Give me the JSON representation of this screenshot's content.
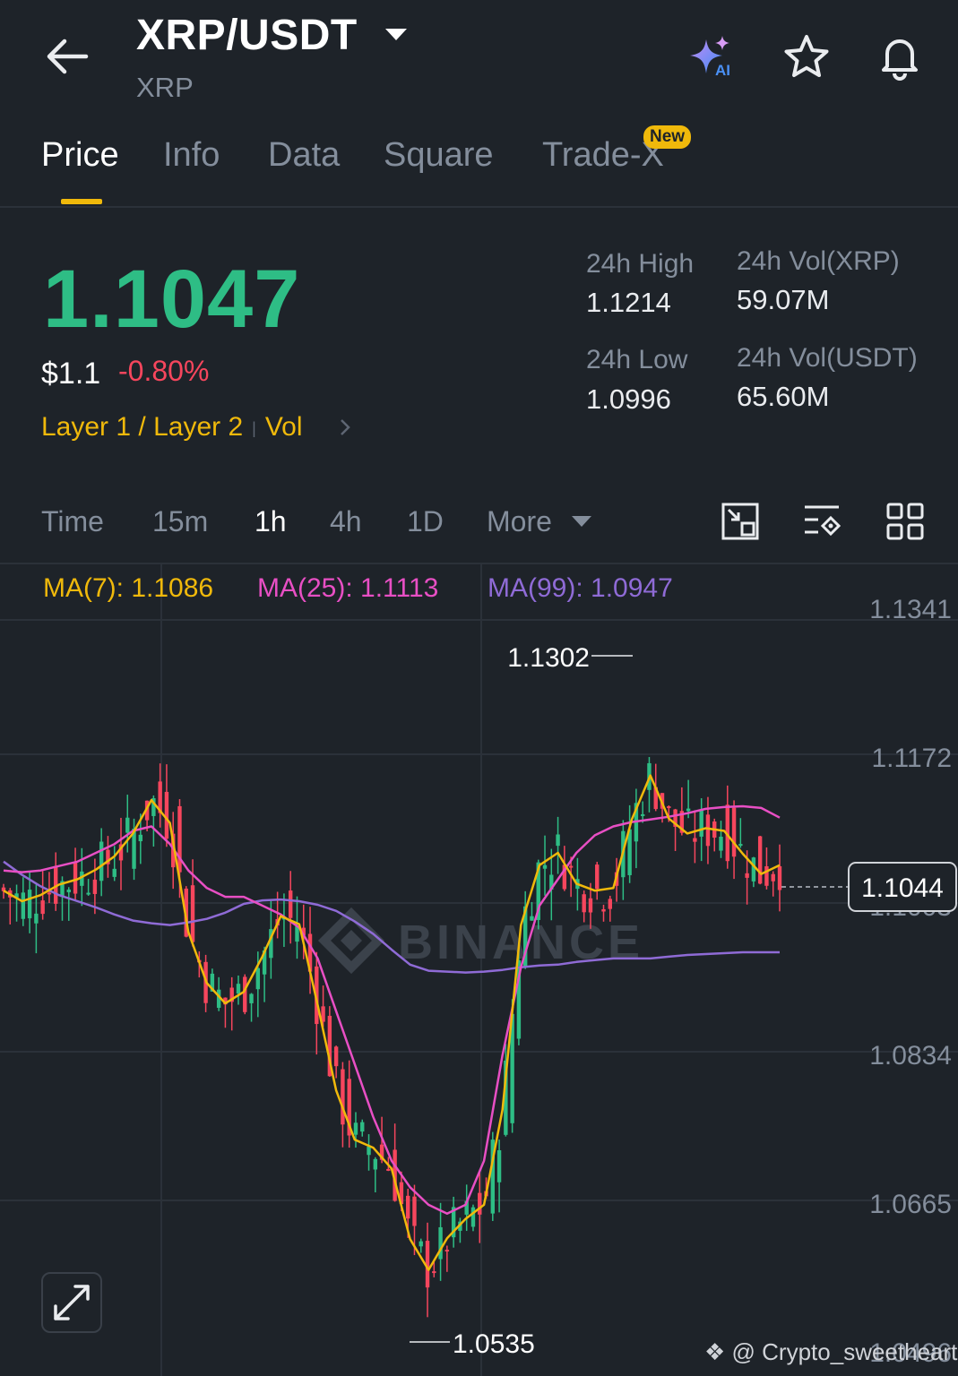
{
  "header": {
    "pair": "XRP/USDT",
    "base": "XRP",
    "icons": [
      "back-arrow-icon",
      "ai-sparkle-icon",
      "star-icon",
      "bell-icon"
    ]
  },
  "tabs": [
    {
      "label": "Price",
      "active": true
    },
    {
      "label": "Info"
    },
    {
      "label": "Data"
    },
    {
      "label": "Square"
    },
    {
      "label": "Trade-X"
    }
  ],
  "new_badge": "New",
  "price": {
    "last": "1.1047",
    "usd": "$1.1",
    "change": "-0.80%",
    "tags": [
      "Layer 1 / Layer 2",
      "Vol"
    ]
  },
  "stats": {
    "high_label": "24h High",
    "high": "1.1214",
    "low_label": "24h Low",
    "low": "1.0996",
    "vol_base_label": "24h Vol(XRP)",
    "vol_base": "59.07M",
    "vol_quote_label": "24h Vol(USDT)",
    "vol_quote": "65.60M"
  },
  "timeframes": [
    {
      "label": "Time"
    },
    {
      "label": "15m"
    },
    {
      "label": "1h",
      "active": true
    },
    {
      "label": "4h"
    },
    {
      "label": "1D"
    },
    {
      "label": "More"
    }
  ],
  "ma": [
    {
      "label": "MA(7): 1.1086",
      "color": "#f0b90b"
    },
    {
      "label": "MA(25): 1.1113",
      "color": "#e84fc4"
    },
    {
      "label": "MA(99): 1.0947",
      "color": "#8f6bd6"
    }
  ],
  "colors": {
    "up": "#2ebd85",
    "down": "#f6465d",
    "accent": "#f0b90b"
  },
  "chart_data": {
    "type": "candlestick",
    "y_ticks": [
      "1.1341",
      "1.1172",
      "1.1003",
      "1.0834",
      "1.0665",
      "1.0496"
    ],
    "ylim": [
      1.0496,
      1.1341
    ],
    "current_price": "1.1044",
    "high_marker": "1.1302",
    "low_marker": "1.0535",
    "watermark": "BINANCE",
    "ma7": [
      1.1017,
      1.1005,
      1.1012,
      1.1024,
      1.103,
      1.1041,
      1.1056,
      1.1082,
      1.112,
      1.1094,
      1.097,
      1.0912,
      1.0889,
      1.0902,
      1.0942,
      1.0988,
      1.0979,
      1.0887,
      1.079,
      1.0734,
      1.0725,
      1.0701,
      1.0621,
      1.0586,
      1.0622,
      1.0644,
      1.066,
      1.0768,
      1.0978,
      1.1046,
      1.106,
      1.1025,
      1.1017,
      1.102,
      1.1098,
      1.1148,
      1.1099,
      1.1082,
      1.1088,
      1.1085,
      1.1059,
      1.1036,
      1.1046
    ],
    "ma25": [
      1.104,
      1.1038,
      1.104,
      1.1045,
      1.105,
      1.106,
      1.107,
      1.1085,
      1.109,
      1.107,
      1.104,
      1.102,
      1.101,
      1.101,
      1.1,
      1.099,
      1.0975,
      1.094,
      1.088,
      1.082,
      1.076,
      1.071,
      1.068,
      1.066,
      1.065,
      1.066,
      1.071,
      1.083,
      1.093,
      1.1,
      1.103,
      1.106,
      1.108,
      1.109,
      1.1095,
      1.1098,
      1.1101,
      1.1105,
      1.111,
      1.1112,
      1.1113,
      1.1111,
      1.11
    ],
    "ma99": [
      1.105,
      1.1035,
      1.1022,
      1.1012,
      1.1005,
      1.0998,
      1.099,
      1.0983,
      1.098,
      1.0978,
      1.0981,
      1.0985,
      1.0992,
      1.1002,
      1.1006,
      1.1007,
      1.1005,
      1.1001,
      1.0994,
      1.0982,
      1.0968,
      1.095,
      1.0933,
      1.0926,
      1.0925,
      1.0924,
      1.0925,
      1.0927,
      1.093,
      1.0932,
      1.0933,
      1.0936,
      1.0938,
      1.094,
      1.094,
      1.094,
      1.0942,
      1.0944,
      1.0945,
      1.0946,
      1.0947,
      1.0947,
      1.0947
    ]
  }
}
